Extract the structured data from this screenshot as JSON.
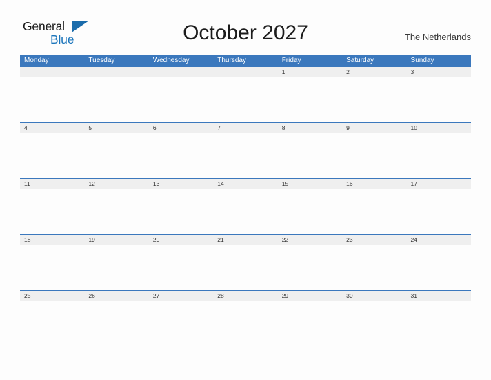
{
  "branding": {
    "name_part1": "General",
    "name_part2": "Blue",
    "flag_icon": "blue-triangle-flag-icon"
  },
  "header": {
    "title": "October 2027",
    "region": "The Netherlands"
  },
  "colors": {
    "header_blue": "#3b78bd",
    "logo_blue": "#1b75bb",
    "date_strip_gray": "#efefef",
    "page_background": "#fdfdfd",
    "title_text": "#1c1c1c",
    "date_text": "#333333"
  },
  "calendar": {
    "weekdays": [
      "Monday",
      "Tuesday",
      "Wednesday",
      "Thursday",
      "Friday",
      "Saturday",
      "Sunday"
    ],
    "weeks": [
      {
        "days": [
          "",
          "",
          "",
          "",
          "1",
          "2",
          "3"
        ]
      },
      {
        "days": [
          "4",
          "5",
          "6",
          "7",
          "8",
          "9",
          "10"
        ]
      },
      {
        "days": [
          "11",
          "12",
          "13",
          "14",
          "15",
          "16",
          "17"
        ]
      },
      {
        "days": [
          "18",
          "19",
          "20",
          "21",
          "22",
          "23",
          "24"
        ]
      },
      {
        "days": [
          "25",
          "26",
          "27",
          "28",
          "29",
          "30",
          "31"
        ]
      }
    ]
  }
}
